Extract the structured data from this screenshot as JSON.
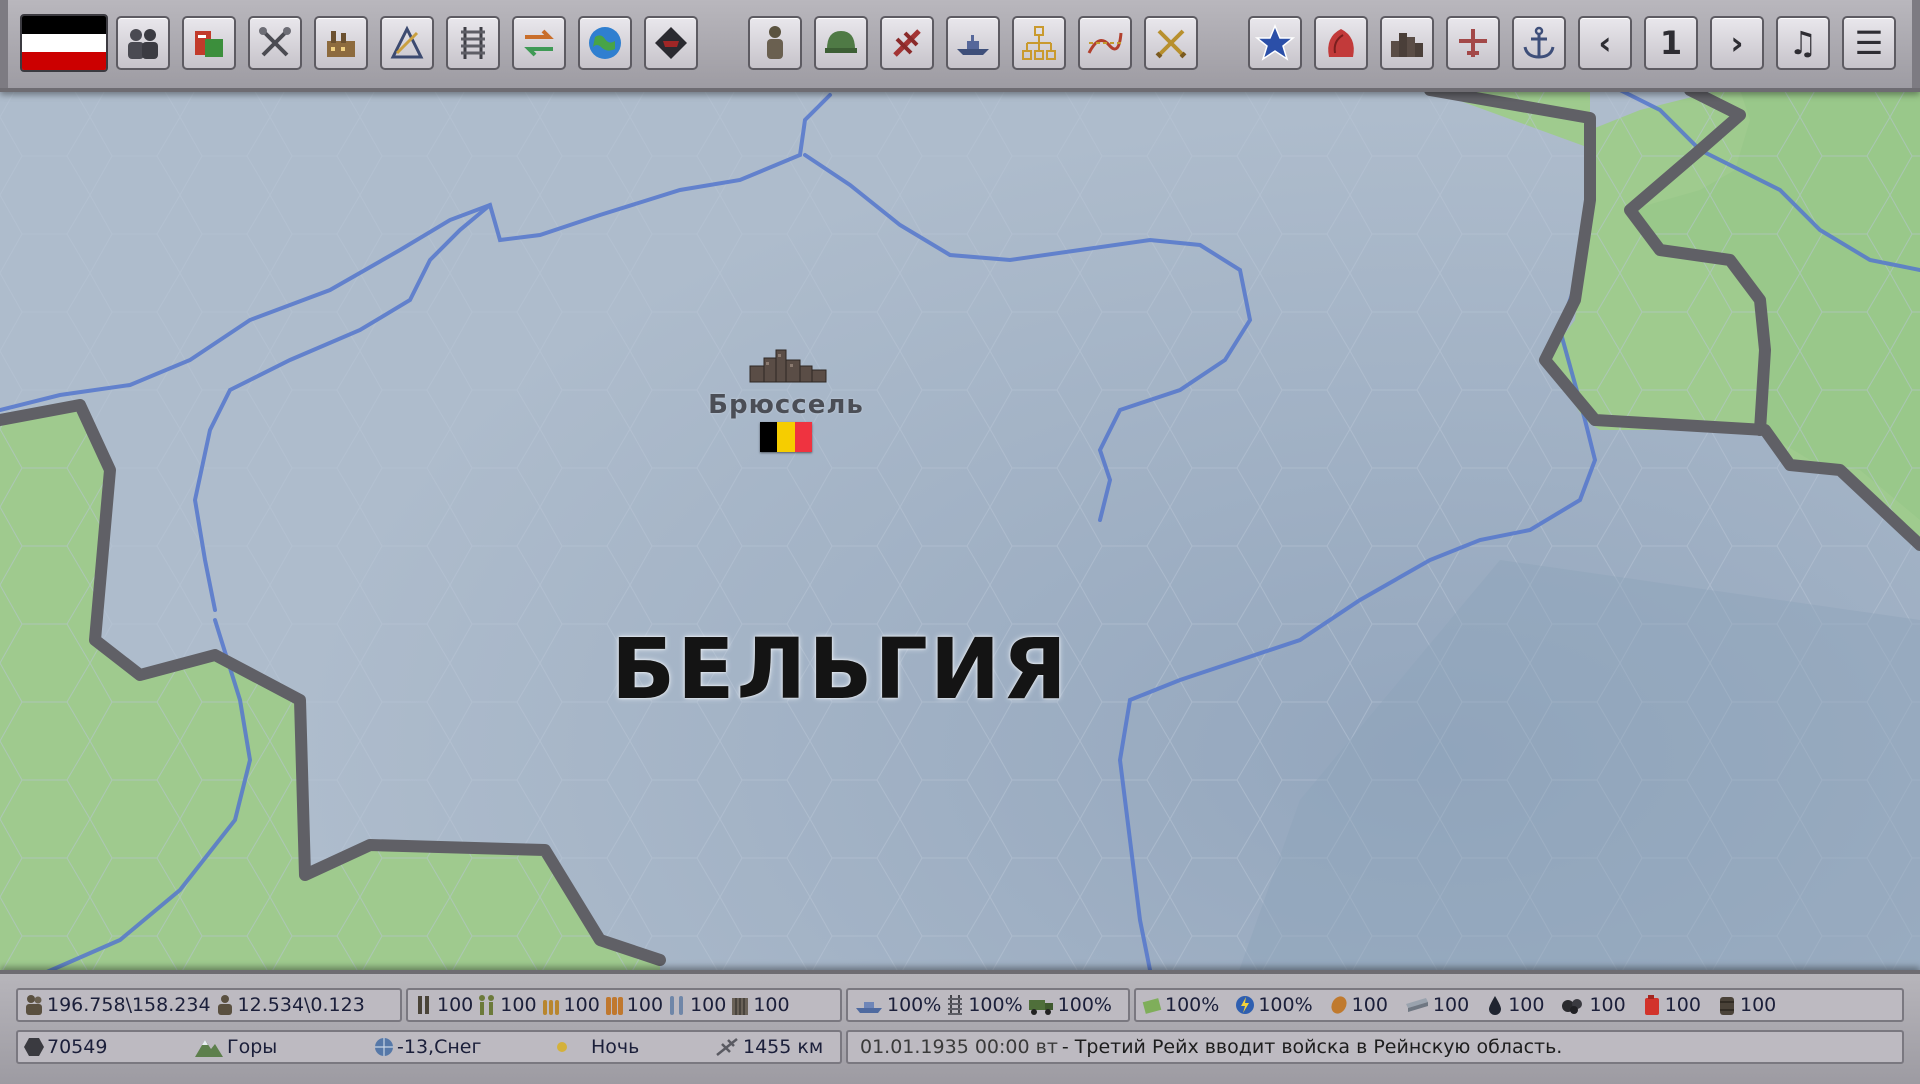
{
  "topbar": {
    "player_flag": [
      "#000000",
      "#ffffff",
      "#cc0000"
    ],
    "left_buttons": [
      {
        "name": "politics-icon"
      },
      {
        "name": "production-icon"
      },
      {
        "name": "research-icon"
      },
      {
        "name": "industry-icon"
      },
      {
        "name": "construction-icon"
      },
      {
        "name": "railway-icon"
      },
      {
        "name": "trade-icon"
      },
      {
        "name": "diplomacy-icon"
      },
      {
        "name": "intelligence-icon"
      }
    ],
    "mid_buttons": [
      {
        "name": "army-icon"
      },
      {
        "name": "infantry-helmet-icon"
      },
      {
        "name": "air-force-icon"
      },
      {
        "name": "navy-icon"
      },
      {
        "name": "command-structure-icon"
      },
      {
        "name": "supply-routes-icon"
      },
      {
        "name": "battles-icon"
      }
    ],
    "right_buttons": [
      {
        "name": "generals-star-icon"
      },
      {
        "name": "resources-icon"
      },
      {
        "name": "cities-icon"
      },
      {
        "name": "airport-icon"
      },
      {
        "name": "port-anchor-icon"
      }
    ],
    "prev_label": "‹",
    "page_number": "1",
    "next_label": "›",
    "music_label": "♫",
    "menu_label": "☰"
  },
  "map": {
    "city_name": "Брюссель",
    "city_flag": [
      "#000000",
      "#f6cd00",
      "#ef3340"
    ],
    "country_name": "БЕЛЬГИЯ",
    "colors": {
      "land_selected": "#aab9c9",
      "land_neighbor": "#9fcc8f",
      "border": "#606066",
      "river": "#5577cc"
    }
  },
  "bottombar": {
    "row1": {
      "manpower": "196.758\\158.234",
      "reserves": "12.534\\0.123",
      "equipment": [
        {
          "icon": "rifle-icon",
          "value": "100"
        },
        {
          "icon": "soldiers-icon",
          "value": "100"
        },
        {
          "icon": "ammo-small-icon",
          "value": "100"
        },
        {
          "icon": "ammo-large-icon",
          "value": "100"
        },
        {
          "icon": "shells-icon",
          "value": "100"
        },
        {
          "icon": "supply-crates-icon",
          "value": "100"
        }
      ],
      "logistics": [
        {
          "icon": "ship-icon",
          "value": "100%"
        },
        {
          "icon": "rail-icon",
          "value": "100%"
        },
        {
          "icon": "truck-icon",
          "value": "100%"
        }
      ],
      "resources": [
        {
          "icon": "money-icon",
          "value": "100%"
        },
        {
          "icon": "energy-icon",
          "value": "100%"
        },
        {
          "icon": "food-icon",
          "value": "100"
        },
        {
          "icon": "steel-icon",
          "value": "100"
        },
        {
          "icon": "oil-icon",
          "value": "100"
        },
        {
          "icon": "coal-icon",
          "value": "100"
        },
        {
          "icon": "fuel-icon",
          "value": "100"
        },
        {
          "icon": "barrels-icon",
          "value": "100"
        }
      ]
    },
    "row2": {
      "hex_id": "70549",
      "terrain": "Горы",
      "weather": "-13,Снег",
      "time_of_day": "Ночь",
      "distance": "1455 км",
      "event_date": "01.01.1935 00:00 вт",
      "event_text": " - Третий Рейх вводит войска в Рейнскую область."
    }
  }
}
